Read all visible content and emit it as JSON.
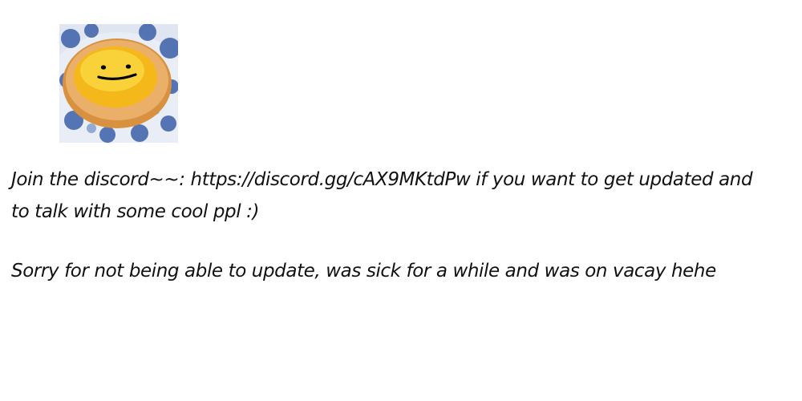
{
  "avatar": {
    "description_icon": "egg-tart-smiley-icon",
    "colors": {
      "plate_blue": "#3b5fa8",
      "plate_white": "#e9eef6",
      "crust": "#e2a257",
      "custard": "#f7c51f",
      "face": "#000000"
    }
  },
  "post": {
    "line1": "Join the discord~~: https://discord.gg/cAX9MKtdPw if you want to get updated and",
    "line2": "to talk with some cool ppl :)",
    "line3": "Sorry for not being able to update, was sick for a while and was on vacay hehe"
  }
}
